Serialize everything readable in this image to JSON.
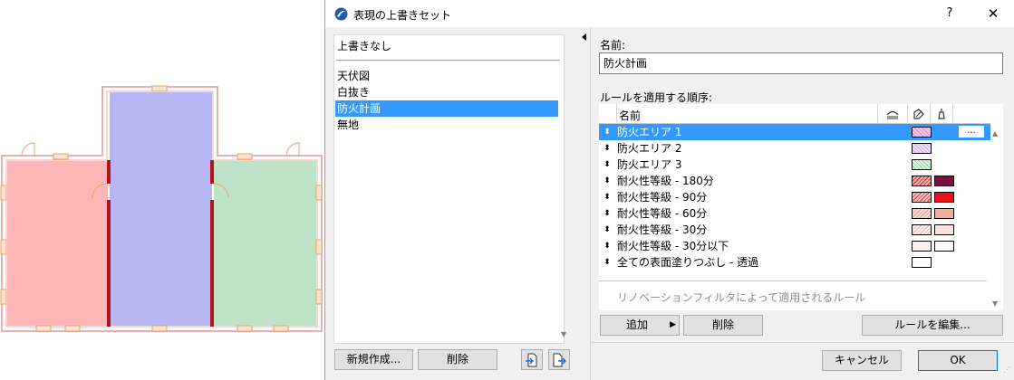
{
  "dialog": {
    "title": "表現の上書きセット",
    "help_label": "?",
    "close_label": "✕",
    "app_icon": "archicad-icon"
  },
  "sets": {
    "no_override": "上書きなし",
    "items": [
      "天伏図",
      "白抜き",
      "防火計画",
      "無地"
    ],
    "selected_index": 2,
    "new_button": "新規作成...",
    "delete_button": "削除",
    "import_icon": "import-icon",
    "export_icon": "export-icon"
  },
  "detail": {
    "name_label": "名前:",
    "name_value": "防火計画",
    "rules_label": "ルールを適用する順序:",
    "column_name": "名前",
    "column_icons": [
      "layer-visibility-icon",
      "fill-pen-icon",
      "surface-icon"
    ],
    "rules": [
      {
        "name": "防火エリア 1",
        "swatch1": {
          "bg": "#f2c6e6",
          "pattern": "hatch-pink"
        },
        "selected": true,
        "dots": "..."
      },
      {
        "name": "防火エリア 2",
        "swatch1": {
          "bg": "#e8d6f2",
          "pattern": "hatch-violet"
        }
      },
      {
        "name": "防火エリア 3",
        "swatch1": {
          "bg": "#d2f0d2",
          "pattern": "hatch-green"
        }
      },
      {
        "name": "耐火性等級 - 180分",
        "swatch1": {
          "bg": "#e05a5a",
          "pattern": "diag-red"
        },
        "swatch2": "#7b0f45"
      },
      {
        "name": "耐火性等級 - 90分",
        "swatch1": {
          "bg": "#f08080",
          "pattern": "diag-red"
        },
        "swatch2": "#ee1111"
      },
      {
        "name": "耐火性等級 - 60分",
        "swatch1": {
          "bg": "#f6b0a0",
          "pattern": "diag-salmon"
        },
        "swatch2": "#f2b09c"
      },
      {
        "name": "耐火性等級 - 30分",
        "swatch1": {
          "bg": "#f9d0c6",
          "pattern": "diag-peach"
        },
        "swatch2": "#f9e2dc"
      },
      {
        "name": "耐火性等級 - 30分以下",
        "swatch1": {
          "bg": "#fbeeec",
          "pattern": "none"
        },
        "swatch2": "#ffffff"
      },
      {
        "name": "全ての表面塗りつぶし - 透過",
        "swatch1": {
          "bg": "#ffffff",
          "pattern": "none"
        }
      }
    ],
    "renovation_note": "リノベーションフィルタによって適用されるルール",
    "add_button": "追加",
    "delete_button": "削除",
    "edit_rules_button": "ルールを編集..."
  },
  "footer": {
    "cancel_button": "キャンセル",
    "ok_button": "OK"
  },
  "plan": {
    "room_colors": {
      "left": "#ffb6b6",
      "center": "#b7b7f4",
      "right": "#bfe3c6",
      "fire_wall": "#b0141e",
      "wall_outline": "#e8b3ae",
      "door": "#e8a267"
    }
  }
}
